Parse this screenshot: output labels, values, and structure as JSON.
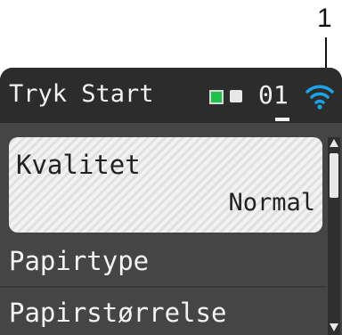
{
  "callout": {
    "label": "1"
  },
  "status": {
    "text": "Tryk Start",
    "copies": "01",
    "wifi_icon": "wifi-icon",
    "led_colors": [
      "#1ec24a",
      "#e7e7e7"
    ]
  },
  "menu": {
    "items": [
      {
        "label": "Kvalitet",
        "value": "Normal"
      },
      {
        "label": "Papirtype"
      },
      {
        "label": "Papirstørrelse"
      }
    ]
  },
  "colors": {
    "accent": "#1ba3e6",
    "screen_bg": "#454545",
    "status_bar_bg": "#2c2c2c",
    "selected_bg": "#f2f2f2"
  }
}
